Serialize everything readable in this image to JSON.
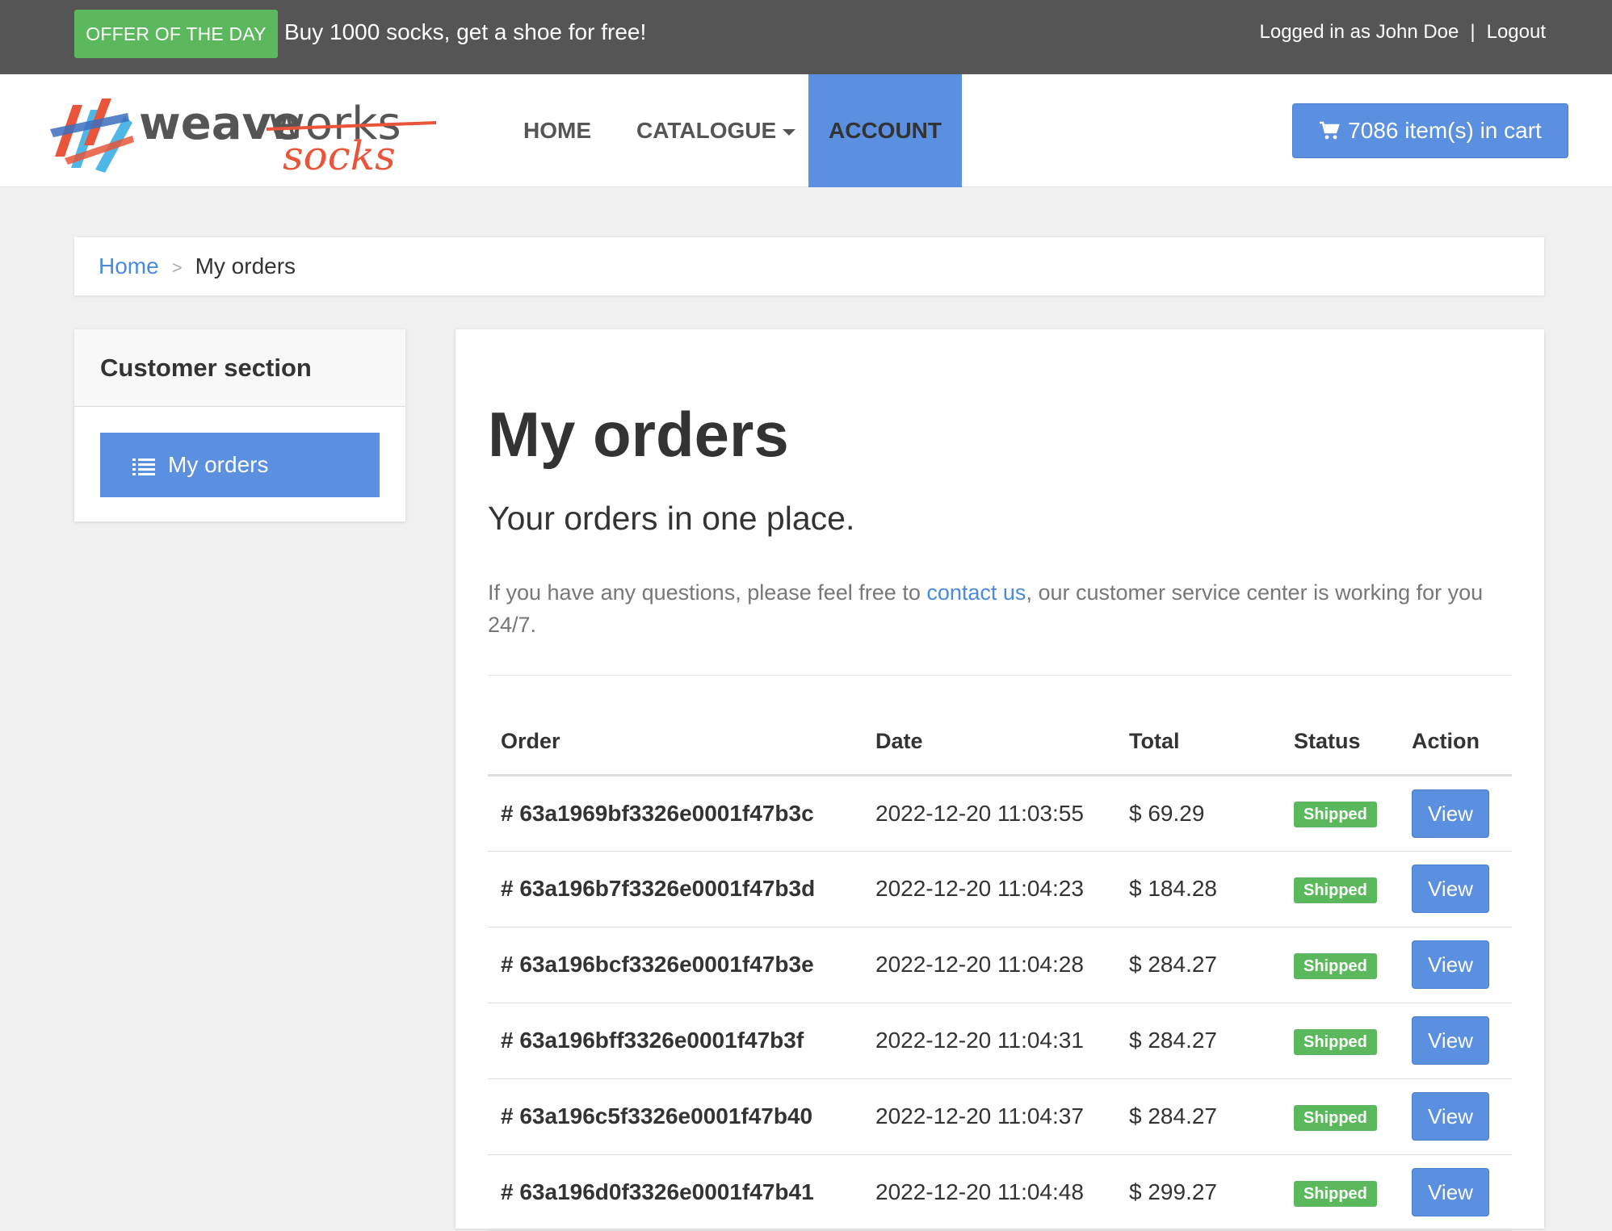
{
  "topbar": {
    "offer_badge": "OFFER OF THE DAY",
    "offer_text": "Buy 1000 socks, get a shoe for free!",
    "logged_in": "Logged in as John Doe",
    "separator": "|",
    "logout": "Logout"
  },
  "logo": {
    "word1": "weave",
    "word2": "works",
    "word3": "socks"
  },
  "nav": {
    "home": "HOME",
    "catalogue": "CATALOGUE",
    "account": "ACCOUNT",
    "cart": "7086 item(s) in cart"
  },
  "breadcrumb": {
    "home": "Home",
    "separator": ">",
    "current": "My orders"
  },
  "sidebar": {
    "title": "Customer section",
    "item": "My orders"
  },
  "main": {
    "title": "My orders",
    "lead": "Your orders in one place.",
    "info_before": "If you have any questions, please feel free to ",
    "info_link": "contact us",
    "info_after": ", our customer service center is working for you 24/7."
  },
  "table": {
    "headers": {
      "order": "Order",
      "date": "Date",
      "total": "Total",
      "status": "Status",
      "action": "Action"
    },
    "rows": [
      {
        "order": "# 63a1969bf3326e0001f47b3c",
        "date": "2022-12-20 11:03:55",
        "total": "$ 69.29",
        "status": "Shipped",
        "action": "View"
      },
      {
        "order": "# 63a196b7f3326e0001f47b3d",
        "date": "2022-12-20 11:04:23",
        "total": "$ 184.28",
        "status": "Shipped",
        "action": "View"
      },
      {
        "order": "# 63a196bcf3326e0001f47b3e",
        "date": "2022-12-20 11:04:28",
        "total": "$ 284.27",
        "status": "Shipped",
        "action": "View"
      },
      {
        "order": "# 63a196bff3326e0001f47b3f",
        "date": "2022-12-20 11:04:31",
        "total": "$ 284.27",
        "status": "Shipped",
        "action": "View"
      },
      {
        "order": "# 63a196c5f3326e0001f47b40",
        "date": "2022-12-20 11:04:37",
        "total": "$ 284.27",
        "status": "Shipped",
        "action": "View"
      },
      {
        "order": "# 63a196d0f3326e0001f47b41",
        "date": "2022-12-20 11:04:48",
        "total": "$ 299.27",
        "status": "Shipped",
        "action": "View"
      }
    ]
  },
  "colors": {
    "topbar": "#555555",
    "accent": "#5b8fdf",
    "success": "#5cb85c",
    "link": "#4a8adf",
    "logo_orange": "#e8553a"
  },
  "icons": {
    "cart": "shopping-cart-icon",
    "list": "list-icon",
    "caret": "chevron-down-icon"
  }
}
